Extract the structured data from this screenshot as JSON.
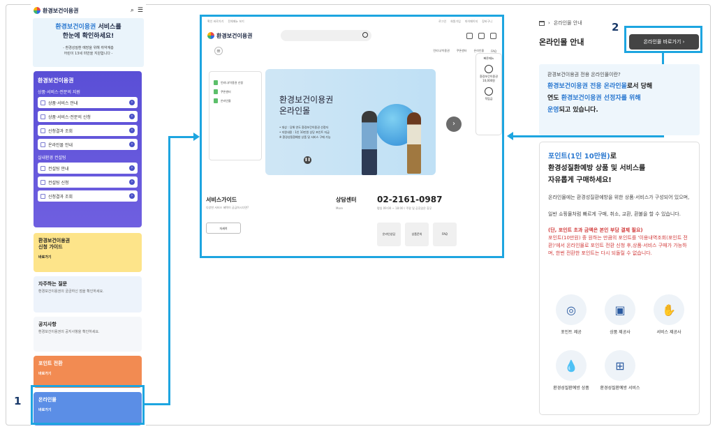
{
  "mobile": {
    "logo": "환경보건이용권",
    "hero_line1": "환경보건이용권",
    "hero_line1b": " 서비스를",
    "hero_line2": "한눈에 확인하세요!",
    "hero_sub1": "- 환경성질환 예방을 위해 취약계층",
    "hero_sub2": "어린이 13세 미만을 지원합니다 -",
    "purple_title": "환경보건이용권",
    "group1": "상품·서비스·전문의 지원",
    "group1_items": [
      "상품·서비스 안내",
      "상품·서비스·전문의 신청",
      "신청결과 조회",
      "온라인몰 안내"
    ],
    "group2": "실내환경 컨설팅",
    "group2_items": [
      "컨설팅 안내",
      "컨설팅 신청",
      "신청결과 조회"
    ],
    "guide_title": "환경보건이용권",
    "guide_title2": "신청 가이드",
    "guide_more": "바로가기",
    "faq_title": "자주하는 질문",
    "faq_sub": "환경보건이용권의 궁금하신 점을 확인하세요.",
    "notice_title": "공지사항",
    "notice_sub": "환경보건이용권의 공지사항을 확인하세요.",
    "point_title": "포인트 전환",
    "point_more": "바로가기",
    "mall_title": "온라인몰",
    "mall_more": "바로가기"
  },
  "labels": {
    "one": "1",
    "two": "2"
  },
  "desktop": {
    "util_left": [
      "확인 바로가기",
      "전체메뉴 보기"
    ],
    "util_right": [
      "로그인",
      "회원가입",
      "마이페이지",
      "장바구니"
    ],
    "logo": "환경보건이용권",
    "nav": [
      "언리나/이용권",
      "쿠폰센터",
      "온라인몰",
      "FAQ"
    ],
    "side": [
      "언리나/이용권 신청",
      "쿠폰센터",
      "온라인몰"
    ],
    "banner_t1": "환경보건이용권",
    "banner_t2": "온라인몰",
    "banner_s1": "• 대상 : 당해 연도 환경보건이용권 선정자",
    "banner_s2": "• 지원내용 : 1인 10만원 상당 포인트 지급",
    "banner_s3": "※ 환경성질환예방 상품 및 서비스 구매 가능",
    "quick_title": "빠른메뉴",
    "quick1": "환경보건이용권 10,000원",
    "quick2": "적립금",
    "service": "서비스가이드",
    "service_sub": "다양한 서비스 혜택이 궁금하시다면?",
    "service_btn": "자세히",
    "center": "상담센터",
    "center_sub": "More",
    "tel": "02-2161-0987",
    "tel_sub": "평일 09:00 ~ 18:00 / 주말 및 공휴일은 휴무",
    "quick_boxes": [
      "온라인상담",
      "상품문의",
      "FAQ"
    ]
  },
  "right": {
    "crumb": "온라인몰 안내",
    "title": "온라인몰 안내",
    "go_button": "온라인몰 바로가기 ›",
    "info_q": "환경보건이용권 전용 온라인몰이란?",
    "info_a1": "환경보건이용권 전용 온라인몰",
    "info_a1b": "로서 당해",
    "info_a2": "연도 ",
    "info_a2b": "환경보건이용권 선정자를 위해",
    "info_a3": "운영",
    "info_a3b": "되고 있습니다.",
    "pb_h1": "포인트(1인 10만원)",
    "pb_h1b": "로",
    "pb_h2": "환경성질환예방 상품 및 서비스를",
    "pb_h3": "자유롭게 구매하세요!",
    "pb_p1": "온라인몰에는 환경성질환예방을 위한 상품·서비스가 구성되어 있으며,",
    "pb_p2": "일반 쇼핑몰처럼 빠르게 구매, 취소, 교환, 환불을 할 수 있습니다.",
    "pb_r_title": "(단, 포인트 초과 금액은 본인 부담 결제 필요)",
    "pb_r_body": "포인트(10만원) 중 원하는 만큼의 포인트를 '이용내역조회(포인트 전환)'에서 온라인몰로 포인트 전환 신청 후,상품·서비스 구매가 가능하며, 한번 전환한 포인트는 다시 되돌릴 수 없습니다.",
    "icons": [
      "포인트 제공",
      "상품 제공사",
      "서비스 제공사",
      "환경성질환예방 상품",
      "환경성질환예방 서비스"
    ]
  }
}
